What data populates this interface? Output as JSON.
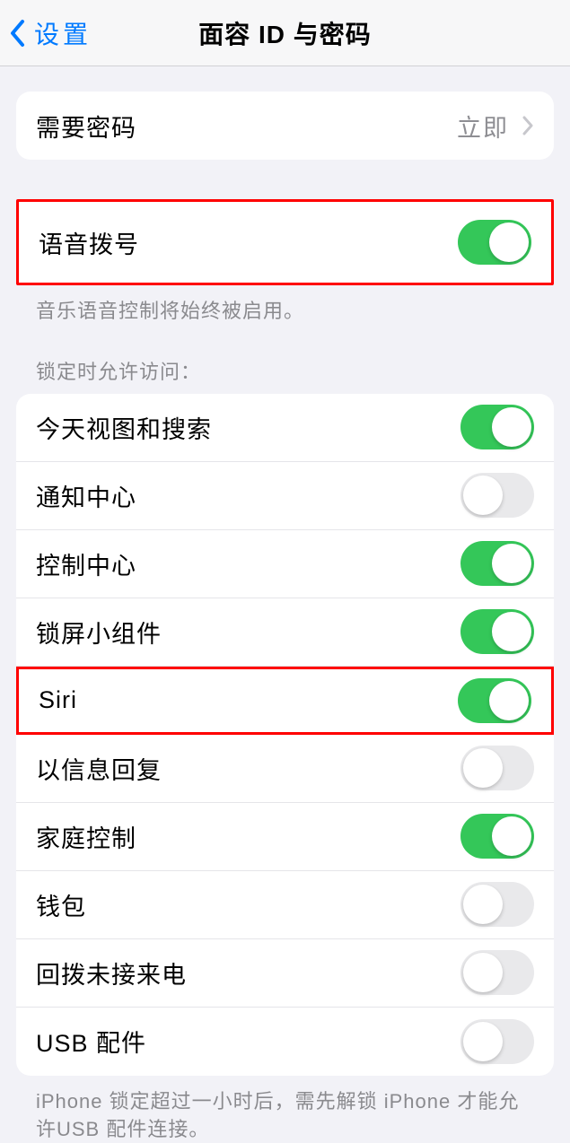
{
  "nav": {
    "back_label": "设置",
    "title": "面容 ID 与密码"
  },
  "passcode": {
    "label": "需要密码",
    "value": "立即"
  },
  "voice": {
    "label": "语音拨号",
    "footer": "音乐语音控制将始终被启用。"
  },
  "lock_access": {
    "header": "锁定时允许访问：",
    "items": [
      {
        "label": "今天视图和搜索",
        "on": true
      },
      {
        "label": "通知中心",
        "on": false
      },
      {
        "label": "控制中心",
        "on": true
      },
      {
        "label": "锁屏小组件",
        "on": true
      },
      {
        "label": "Siri",
        "on": true
      },
      {
        "label": "以信息回复",
        "on": false
      },
      {
        "label": "家庭控制",
        "on": true
      },
      {
        "label": "钱包",
        "on": false
      },
      {
        "label": "回拨未接来电",
        "on": false
      },
      {
        "label": "USB 配件",
        "on": false
      }
    ],
    "footer": "iPhone 锁定超过一小时后，需先解锁 iPhone 才能允许USB 配件连接。"
  }
}
